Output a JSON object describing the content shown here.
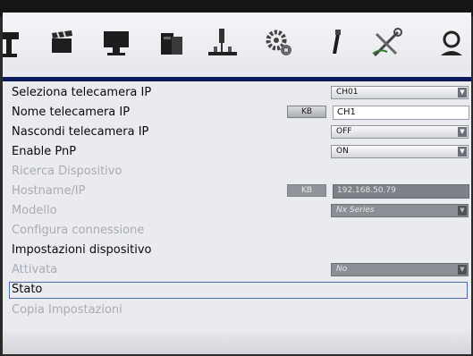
{
  "toolbar": {
    "icons": [
      "camera-icon",
      "clapperboard-icon",
      "monitor-icon",
      "hard-drive-icon",
      "network-icon",
      "gears-icon",
      "usb-icon",
      "tools-icon",
      "user-icon"
    ]
  },
  "settings": {
    "select_camera": {
      "label": "Seleziona telecamera IP",
      "value": "CH01"
    },
    "camera_name": {
      "label": "Nome telecamera IP",
      "kb": "KB",
      "value": "CH1"
    },
    "hide_camera": {
      "label": "Nascondi telecamera IP",
      "value": "OFF"
    },
    "enable_pnp": {
      "label": "Enable PnP",
      "value": "ON"
    },
    "search_device": {
      "label": "Ricerca Dispositivo"
    },
    "hostname": {
      "label": "Hostname/IP",
      "kb": "KB",
      "value": "192.168.50.79"
    },
    "model": {
      "label": "Modello",
      "value": "Nx Series"
    },
    "configure_connection": {
      "label": "Configura connessione"
    },
    "device_settings": {
      "label": "Impostazioni dispositivo"
    },
    "activated": {
      "label": "Attivata",
      "value": "No"
    },
    "status": {
      "label": "Stato"
    },
    "copy_settings": {
      "label": "Copia Impostazioni"
    }
  }
}
